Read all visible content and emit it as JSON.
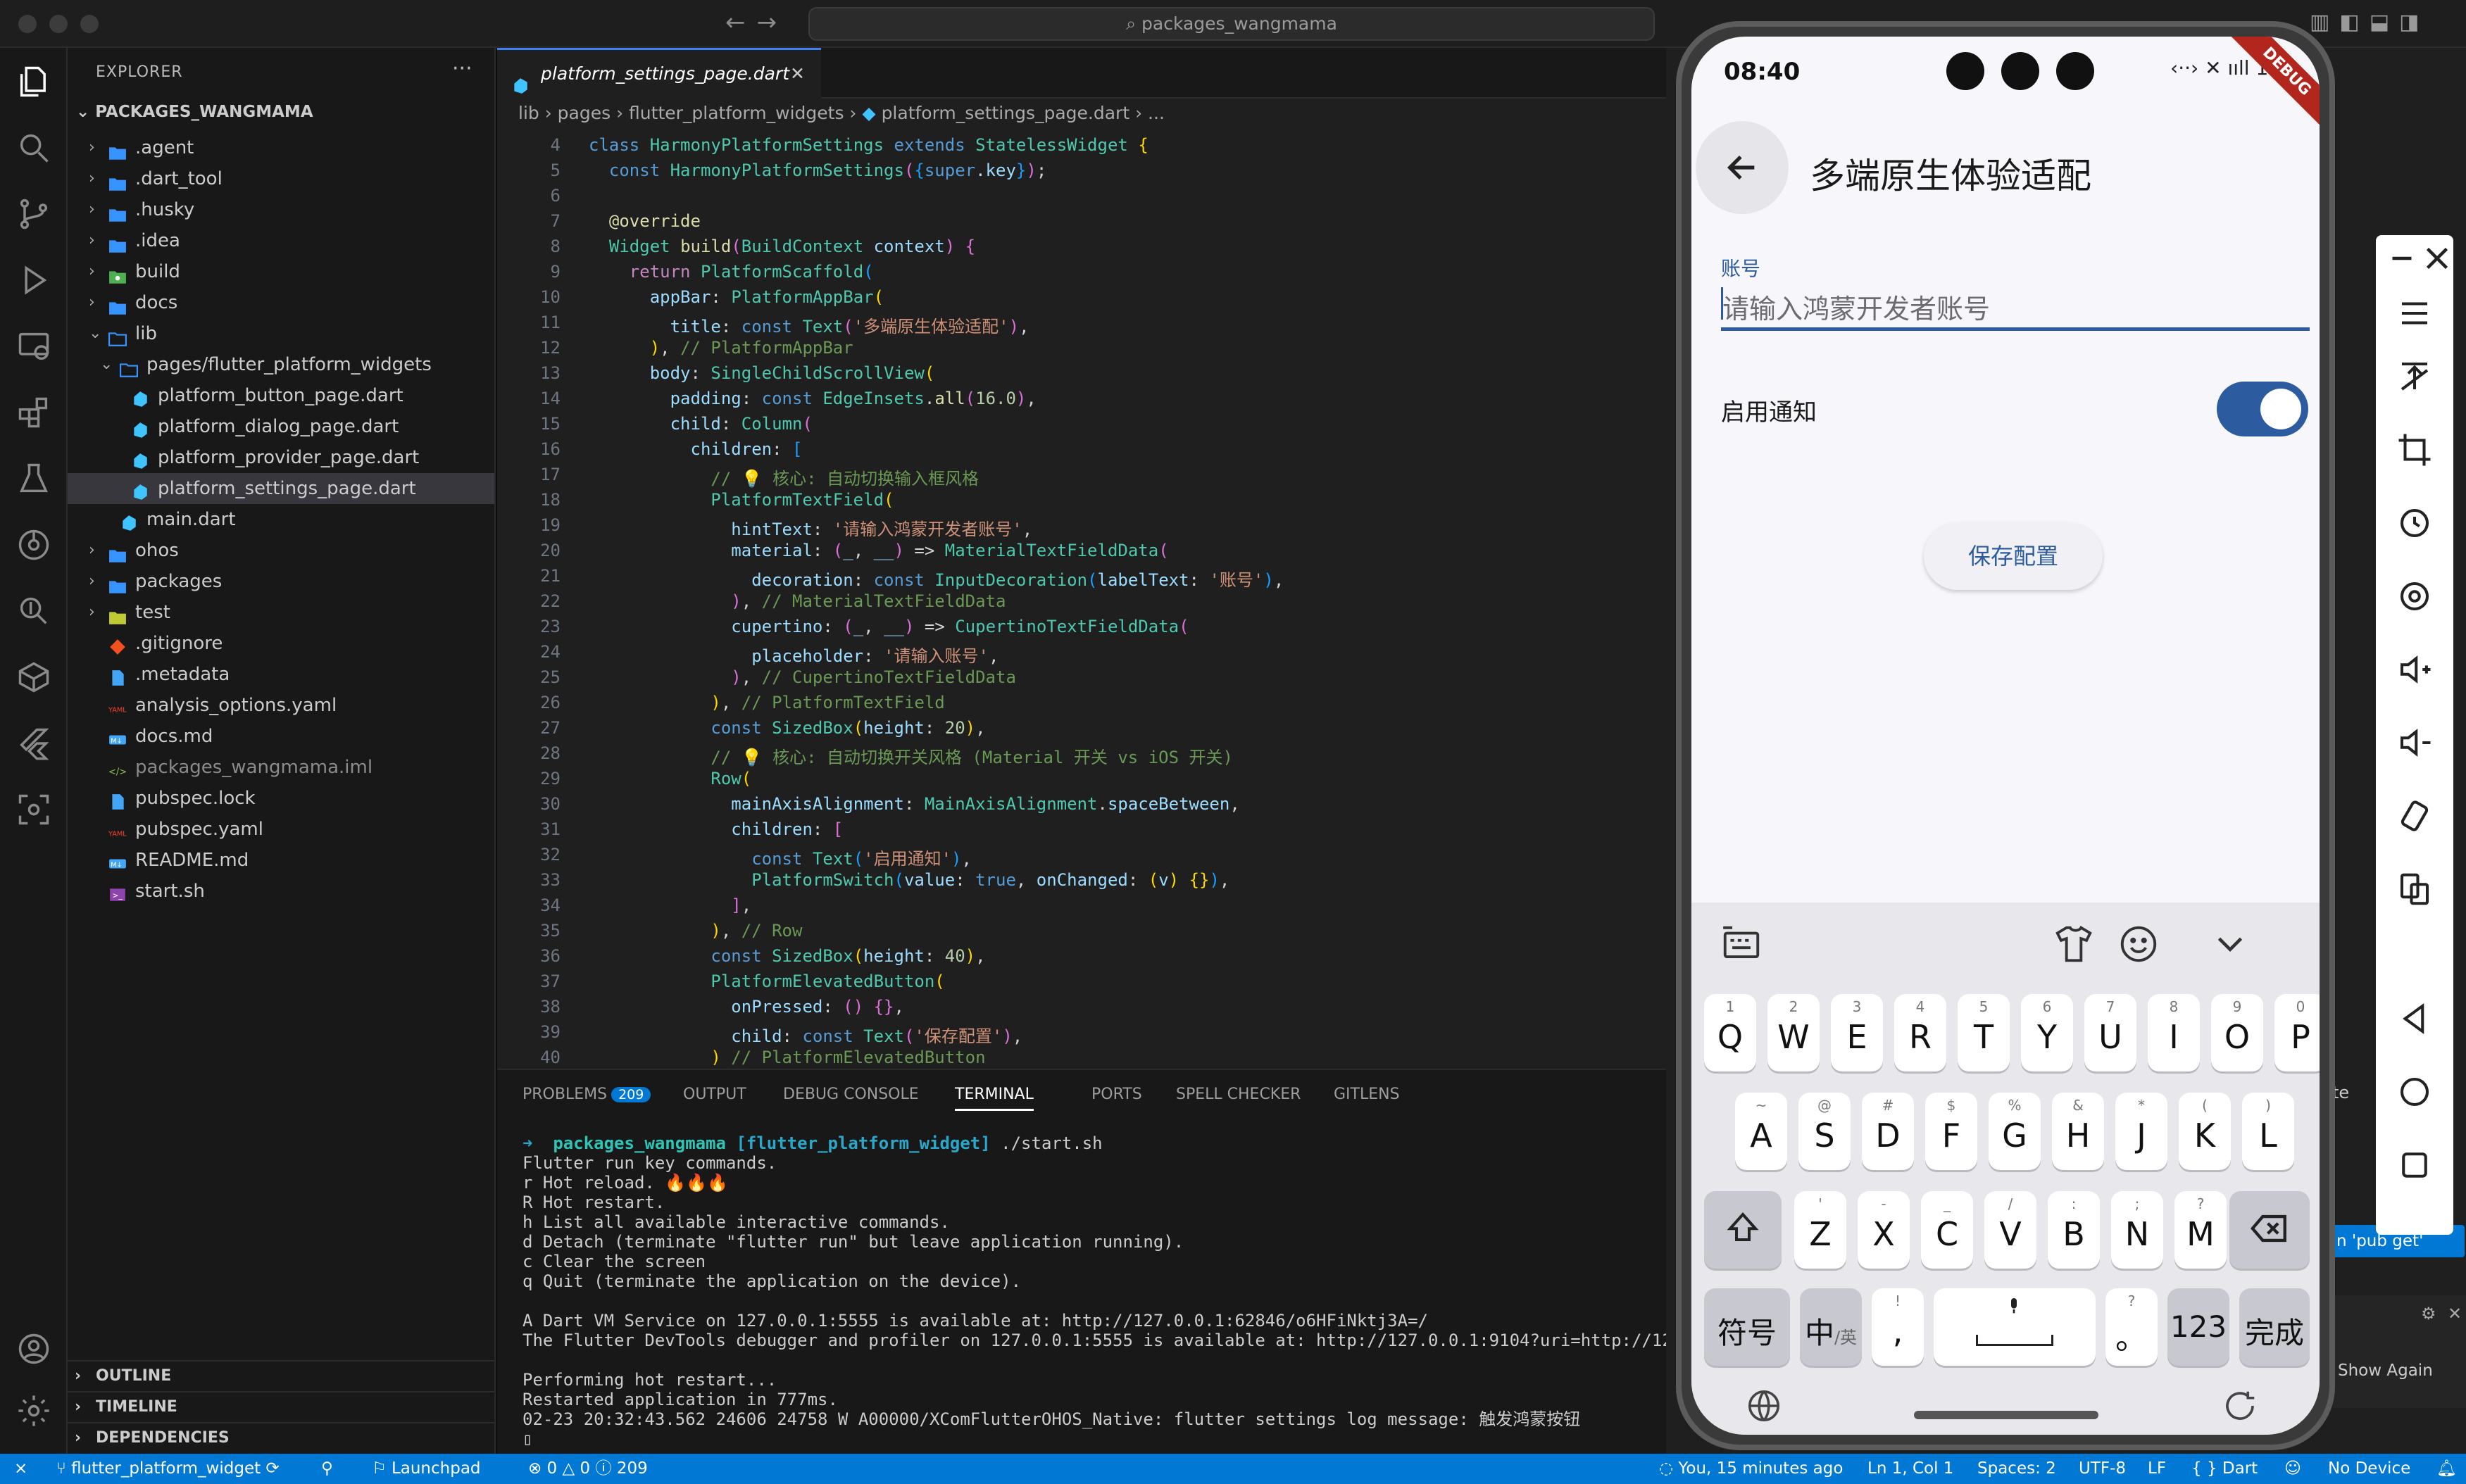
{
  "window": {
    "search_text": "packages_wangmama"
  },
  "explorer": {
    "title": "EXPLORER",
    "more": "···",
    "root": "PACKAGES_WANGMAMA",
    "items": [
      {
        "label": ".agent"
      },
      {
        "label": ".dart_tool"
      },
      {
        "label": ".husky"
      },
      {
        "label": ".idea"
      },
      {
        "label": "build"
      },
      {
        "label": "docs"
      },
      {
        "label": "lib"
      },
      {
        "label": "pages/flutter_platform_widgets"
      },
      {
        "label": "platform_button_page.dart"
      },
      {
        "label": "platform_dialog_page.dart"
      },
      {
        "label": "platform_provider_page.dart"
      },
      {
        "label": "platform_settings_page.dart"
      },
      {
        "label": "main.dart"
      },
      {
        "label": "ohos"
      },
      {
        "label": "packages"
      },
      {
        "label": "test"
      },
      {
        "label": ".gitignore"
      },
      {
        "label": ".metadata"
      },
      {
        "label": "analysis_options.yaml"
      },
      {
        "label": "docs.md"
      },
      {
        "label": "packages_wangmama.iml"
      },
      {
        "label": "pubspec.lock"
      },
      {
        "label": "pubspec.yaml"
      },
      {
        "label": "README.md"
      },
      {
        "label": "start.sh"
      }
    ],
    "sections": [
      "OUTLINE",
      "TIMELINE",
      "DEPENDENCIES"
    ]
  },
  "editor": {
    "tab_label": "platform_settings_page.dart",
    "tab_close": "✕",
    "breadcrumb": [
      "lib",
      "pages",
      "flutter_platform_widgets",
      "platform_settings_page.dart",
      "..."
    ],
    "line_numbers": [
      "4",
      "5",
      "6",
      "7",
      "8",
      "9",
      "10",
      "11",
      "12",
      "13",
      "14",
      "15",
      "16",
      "17",
      "18",
      "19",
      "20",
      "21",
      "22",
      "23",
      "24",
      "25",
      "26",
      "27",
      "28",
      "29",
      "30",
      "31",
      "32",
      "33",
      "34",
      "35",
      "36",
      "37",
      "38",
      "39",
      "40"
    ]
  },
  "panel": {
    "tabs": [
      "PROBLEMS",
      "OUTPUT",
      "DEBUG CONSOLE",
      "TERMINAL",
      "PORTS",
      "SPELL CHECKER",
      "GITLENS"
    ],
    "problems_count": "209",
    "terminal": {
      "prompt_dir": "packages_wangmama",
      "prompt_branch": "[flutter_platform_widget]",
      "prompt_cmd": "./start.sh",
      "lines": [
        "Flutter run key commands.",
        "r Hot reload. 🔥🔥🔥",
        "R Hot restart.",
        "h List all available interactive commands.",
        "d Detach (terminate \"flutter run\" but leave application running).",
        "c Clear the screen",
        "q Quit (terminate the application on the device).",
        "",
        "A Dart VM Service on 127.0.0.1:5555 is available at: http://127.0.0.1:62846/o6HFiNktj3A=/",
        "The Flutter DevTools debugger and profiler on 127.0.0.1:5555 is available at: http://127.0.0.1:9104?uri=http://127.0",
        "",
        "Performing hot restart...",
        "Restarted application in 777ms.",
        "02-23 20:32:43.562 24606 24758 W A00000/XComFlutterOHOS_Native: flutter settings log message: 触发鸿蒙按钮",
        "▯"
      ]
    }
  },
  "statusbar": {
    "branch": "flutter_platform_widget",
    "launchpad": "Launchpad",
    "errors": "0",
    "warnings": "0",
    "infos": "209",
    "blame": "You, 15 minutes ago",
    "position": "Ln 1, Col 1",
    "spaces": "Spaces: 2",
    "encoding": "UTF-8",
    "eol": "LF",
    "language": "Dart",
    "device": "No Device"
  },
  "right_fragments": {
    "pub_get": "n 'pub get'",
    "show_again": "Show Again",
    "te": "te"
  },
  "phone": {
    "time": "08:40",
    "sys_icons": "‹··› ✕ ııll 100",
    "debug_banner": "DEBUG",
    "title": "多端原生体验适配",
    "field_label": "账号",
    "field_placeholder": "请输入鸿蒙开发者账号",
    "switch_label": "启用通知",
    "switch_on": true,
    "save_button": "保存配置",
    "keyboard": {
      "row1": [
        [
          "1",
          "Q"
        ],
        [
          "2",
          "W"
        ],
        [
          "3",
          "E"
        ],
        [
          "4",
          "R"
        ],
        [
          "5",
          "T"
        ],
        [
          "6",
          "Y"
        ],
        [
          "7",
          "U"
        ],
        [
          "8",
          "I"
        ],
        [
          "9",
          "O"
        ],
        [
          "0",
          "P"
        ]
      ],
      "row2": [
        [
          "~",
          "A"
        ],
        [
          "@",
          "S"
        ],
        [
          "#",
          "D"
        ],
        [
          "$",
          "F"
        ],
        [
          "%",
          "G"
        ],
        [
          "&",
          "H"
        ],
        [
          "*",
          "J"
        ],
        [
          "(",
          "K"
        ],
        [
          ")",
          "L"
        ]
      ],
      "row3": [
        [
          "'",
          "Z"
        ],
        [
          "-",
          "X"
        ],
        [
          "_",
          "C"
        ],
        [
          "/",
          "V"
        ],
        [
          ":",
          "B"
        ],
        [
          ";",
          "N"
        ],
        [
          "?",
          "M"
        ]
      ],
      "symbols": "符号",
      "lang_main": "中",
      "lang_sub": "/英",
      "comma_sup": "!",
      "comma": ",",
      "period_sup": "?",
      "period": "。",
      "numbers": "123",
      "done": "完成"
    }
  }
}
